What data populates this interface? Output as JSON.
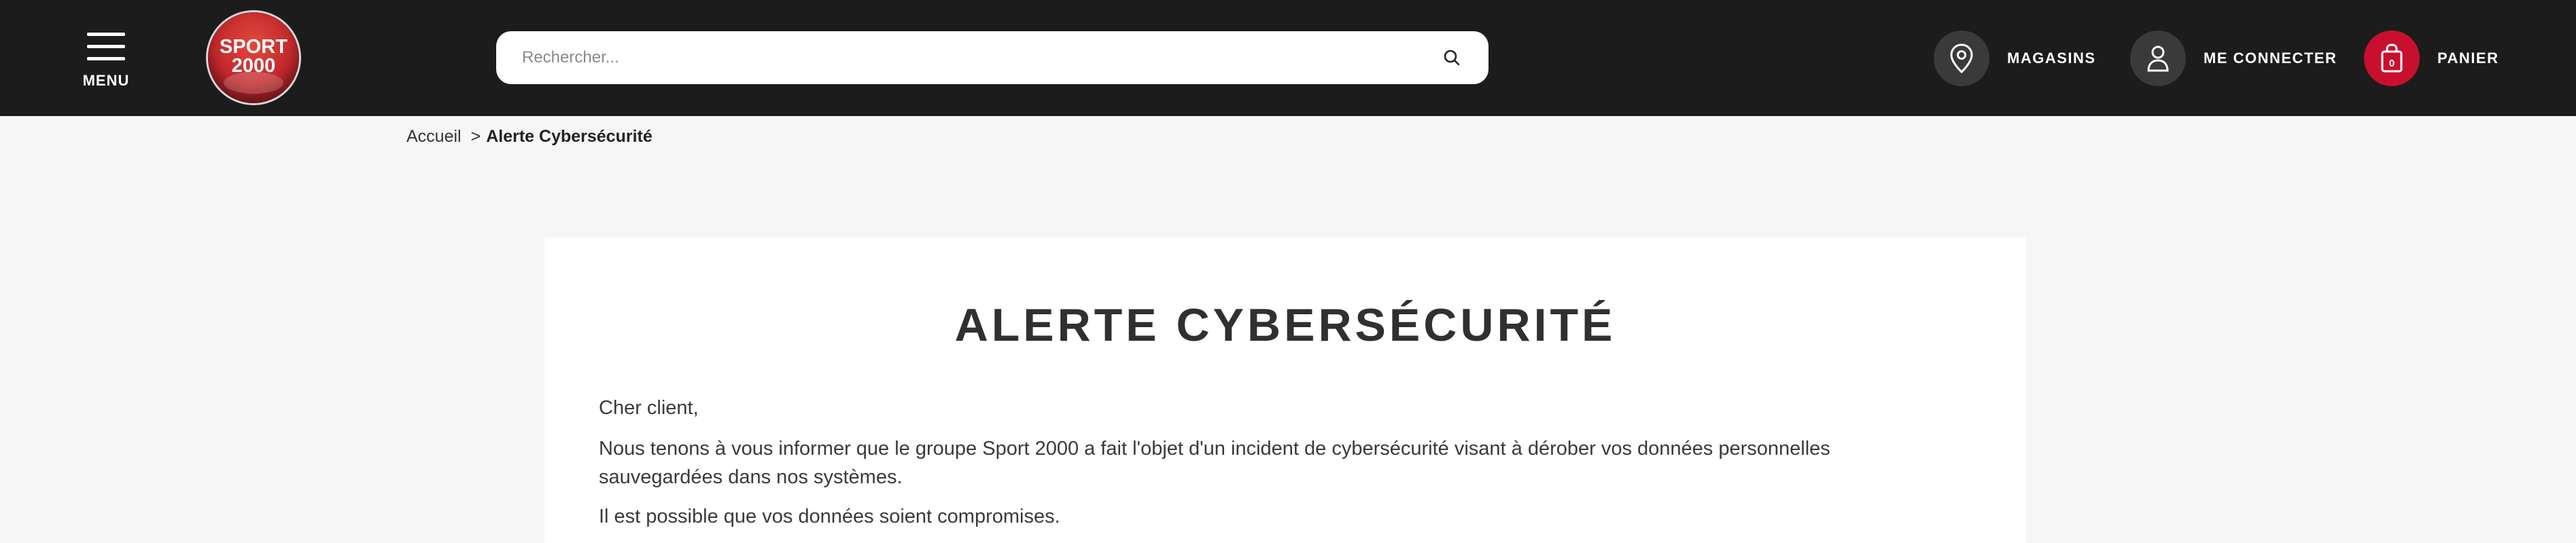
{
  "header": {
    "menu_label": "MENU",
    "logo": {
      "line1": "SPORT",
      "line2": "2000"
    },
    "search": {
      "placeholder": "Rechercher...",
      "value": ""
    },
    "stores_label": "MAGASINS",
    "login_label": "ME CONNECTER",
    "cart_label": "PANIER",
    "cart_count": "0",
    "colors": {
      "background": "#1c1c1c",
      "accent": "#c8102e"
    }
  },
  "breadcrumb": {
    "home": "Accueil",
    "separator": ">",
    "current": "Alerte Cybersécurité"
  },
  "main": {
    "title": "ALERTE CYBERSÉCURITÉ",
    "paragraphs": [
      "Cher client,",
      "Nous tenons à vous informer que le groupe Sport 2000 a fait l'objet d'un incident de cybersécurité visant à dérober vos données personnelles sauvegardées dans nos systèmes.",
      "Il est possible que vos données soient compromises."
    ]
  },
  "icons": {
    "menu": "hamburger-icon",
    "search": "search-icon",
    "stores": "map-pin-icon",
    "login": "user-icon",
    "cart": "shopping-bag-icon"
  }
}
